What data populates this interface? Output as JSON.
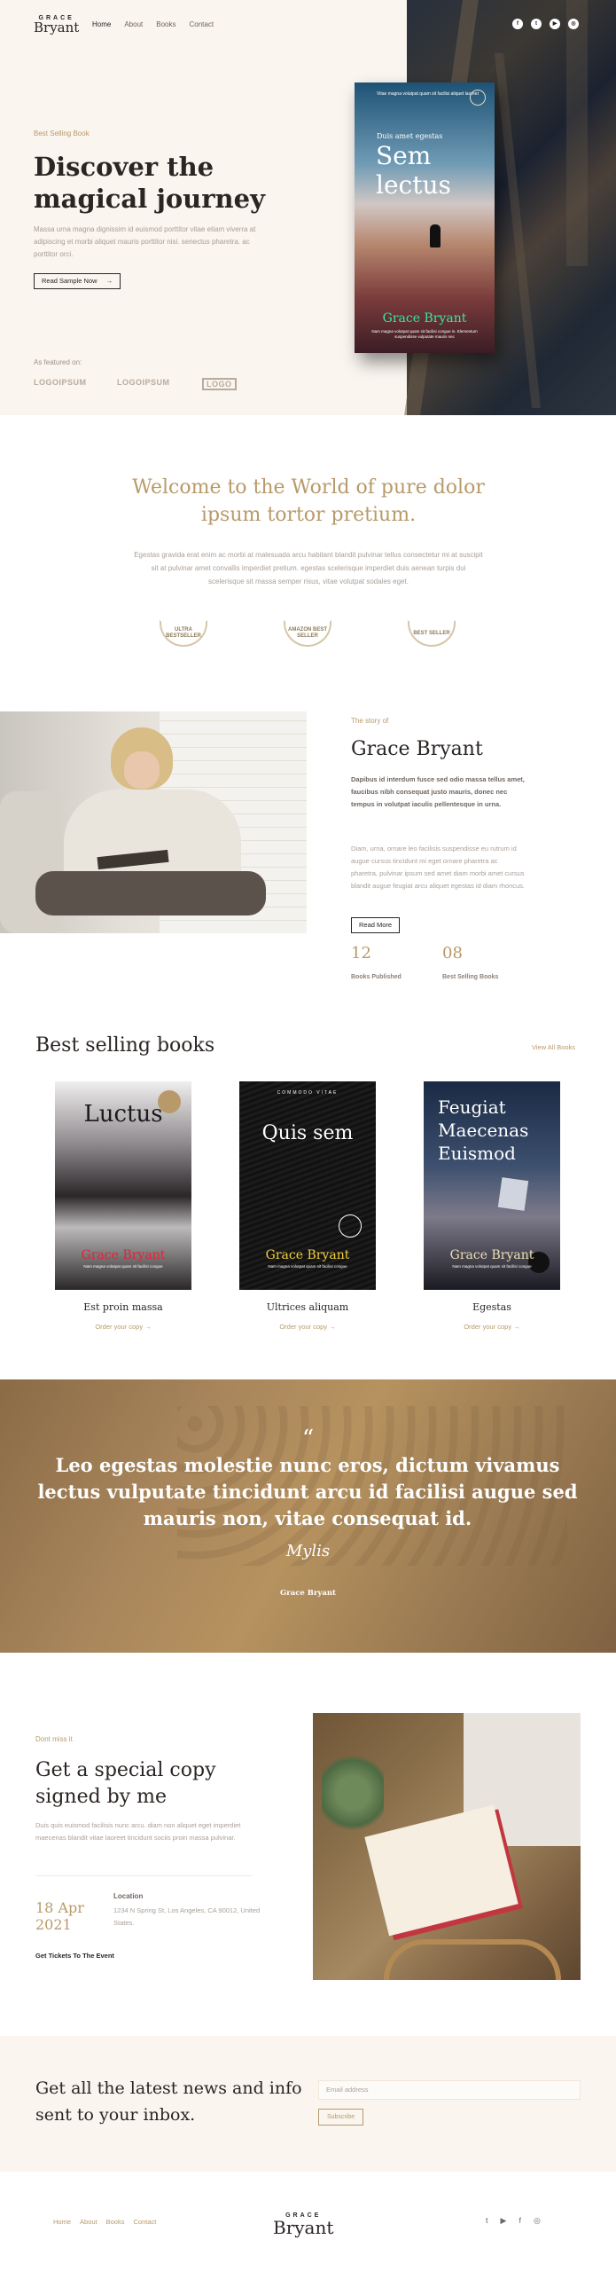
{
  "brand": {
    "small": "GRACE",
    "big": "Bryant"
  },
  "nav": [
    "Home",
    "About",
    "Books",
    "Contact"
  ],
  "socials": [
    "facebook-icon",
    "twitter-icon",
    "youtube-icon",
    "instagram-icon"
  ],
  "hero": {
    "eyebrow": "Best Selling Book",
    "title": "Discover the magical journey",
    "description": "Massa urna magna dignissim id euismod porttitor vitae etiam viverra at adipiscing et morbi aliquet mauris porttitor nisi. senectus pharetra. ac porttitor orci.",
    "button": "Read Sample Now",
    "featured_label": "As featured on:",
    "press": [
      "LOGOIPSUM",
      "LOGOIPSUM",
      "LOGO"
    ],
    "book": {
      "top_text": "Vitae magna volutpat quam sit facilisi aliquet laoreet",
      "subtitle": "Duis amet egestas",
      "title": "Sem lectus",
      "author": "Grace Bryant",
      "tagline": "Nam magna volutpat quam sit facilisi congue in. Elementum suspendisse vulputate mauris nec"
    }
  },
  "welcome": {
    "title": "Welcome to the World of pure dolor ipsum tortor pretium.",
    "description": "Egestas gravida erat enim ac morbi at malesuada arcu habitant blandit pulvinar tellus consectetur mi at suscipit sit at pulvinar amet convallis imperdiet pretium. egestas scelerisque imperdiet duis aenean turpis dui scelerisque sit massa semper risus, vitae volutpat sodales eget.",
    "awards": [
      "ULTRA BESTSELLER",
      "AMAZON BEST SELLER",
      "BEST SELLER"
    ]
  },
  "story": {
    "eyebrow": "The story of",
    "name": "Grace Bryant",
    "lead": "Dapibus id interdum fusce sed odio massa tellus amet, faucibus nibh consequat justo mauris, donec nec tempus in volutpat iaculis pellentesque in urna.",
    "body": "Diam, urna, ornare leo facilisis suspendisse eu rutrum id augue cursus tincidunt mi eget ornare pharetra ac pharetra, pulvinar ipsum sed amet diam morbi amet cursus blandit augue feugiat arcu aliquet egestas id diam rhoncus.",
    "button": "Read More",
    "stats": [
      {
        "num": "12",
        "label": "Books Published"
      },
      {
        "num": "08",
        "label": "Best Selling Books"
      }
    ]
  },
  "books": {
    "title": "Best selling books",
    "view_all": "View All Books",
    "items": [
      {
        "cover_title": "Luctus",
        "cover_author": "Grace Bryant",
        "name": "Est proin massa",
        "order": "Order your copy"
      },
      {
        "cover_title": "Quis sem",
        "cover_author": "Grace Bryant",
        "cover_top": "COMMODO VITAE",
        "name": "Ultrices aliquam",
        "order": "Order your copy"
      },
      {
        "cover_title": "Feugiat Maecenas Euismod",
        "cover_author": "Grace Bryant",
        "name": "Egestas",
        "order": "Order your copy"
      }
    ]
  },
  "quote": {
    "mark": "“",
    "text": "Leo egestas molestie nunc eros, dictum vivamus lectus vulputate tincidunt arcu id facilisi augue sed mauris non, vitae consequat id.",
    "author": "Grace Bryant"
  },
  "event": {
    "eyebrow": "Dont miss it",
    "title": "Get a special copy signed by me",
    "description": "Duis quis euismod facilisis nunc arcu. diam non aliquet eget imperdiet maecenas blandit vitae laoreet tincidunt sociis proin massa pulvinar.",
    "date": "18 Apr 2021",
    "location_label": "Location",
    "location": "1234 N Spring St, Los Angeles, CA 90012, United States.",
    "tickets": "Get Tickets To The Event"
  },
  "newsletter": {
    "title": "Get all the latest news and info sent to your inbox.",
    "placeholder": "Email address",
    "button": "Subscribe"
  },
  "footer": {
    "nav": [
      "Home",
      "About",
      "Books",
      "Contact"
    ],
    "socials": [
      "twitter-icon",
      "youtube-icon",
      "facebook-icon",
      "instagram-icon"
    ]
  },
  "colors": {
    "accent": "#b89a6a",
    "text": "#2b2523",
    "cream": "#faf5ef"
  }
}
